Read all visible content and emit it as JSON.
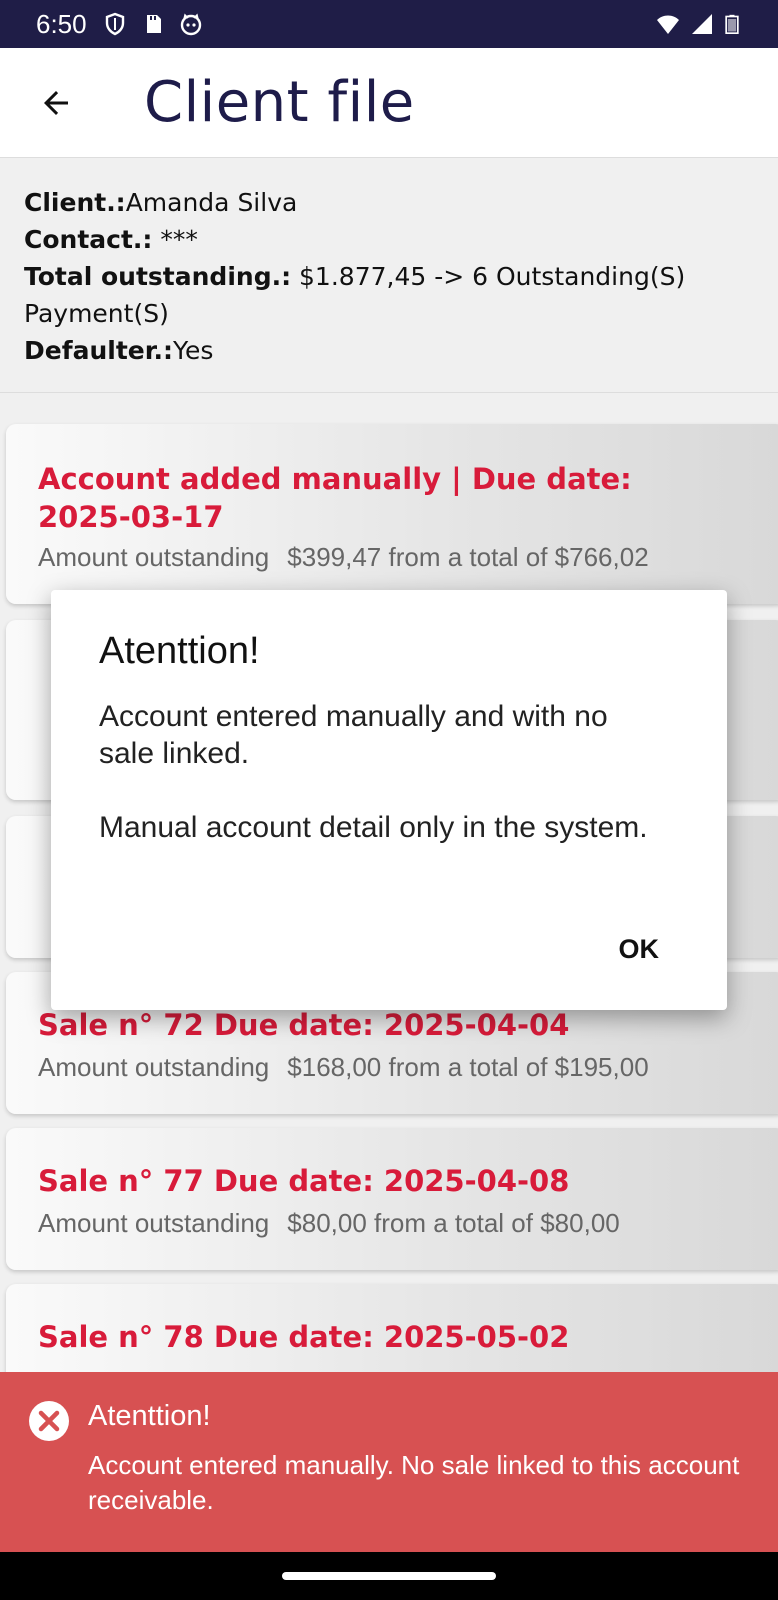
{
  "status_bar": {
    "time": "6:50",
    "icons_left": [
      "shield-icon",
      "sd-card-icon",
      "cat-icon"
    ],
    "icons_right": [
      "wifi-icon",
      "signal-icon",
      "battery-icon"
    ]
  },
  "app_bar": {
    "title": "Client file",
    "back_icon": "arrow-back-icon"
  },
  "client": {
    "client_label": "Client.:",
    "client_value": "Amanda Silva",
    "contact_label": "Contact.:",
    "contact_value": " ***",
    "total_label": "Total outstanding.:",
    "total_value": " $1.877,45 -> 6 Outstanding(S) Payment(S)",
    "defaulter_label": "Defaulter.:",
    "defaulter_value": "Yes"
  },
  "accounts": [
    {
      "title": "Account added manually  | Due date: 2025-03-17",
      "amount_label": "Amount outstanding",
      "amount_text": "$399,47 from a total of  $766,02"
    },
    {
      "title": "Sale n° 72 Due date: 2025-04-04",
      "amount_label": "Amount outstanding",
      "amount_text": "$168,00 from a total of  $195,00"
    },
    {
      "title": "Sale n° 77 Due date: 2025-04-08",
      "amount_label": "Amount outstanding",
      "amount_text": "$80,00 from a total of  $80,00"
    },
    {
      "title": "Sale n° 78 Due date: 2025-05-02"
    }
  ],
  "dialog": {
    "title": "Atenttion!",
    "body": "Account entered manually and with no sale linked.\n\n Manual account detail only in the system.",
    "ok_label": "OK"
  },
  "snackbar": {
    "icon": "close-circle-icon",
    "title": "Atenttion!",
    "message": "Account entered manually. No sale linked to this account receivable."
  },
  "colors": {
    "status_bar": "#1f1d47",
    "title": "#1e1c4a",
    "account_title": "#d81b3a",
    "snackbar": "#d75152"
  }
}
